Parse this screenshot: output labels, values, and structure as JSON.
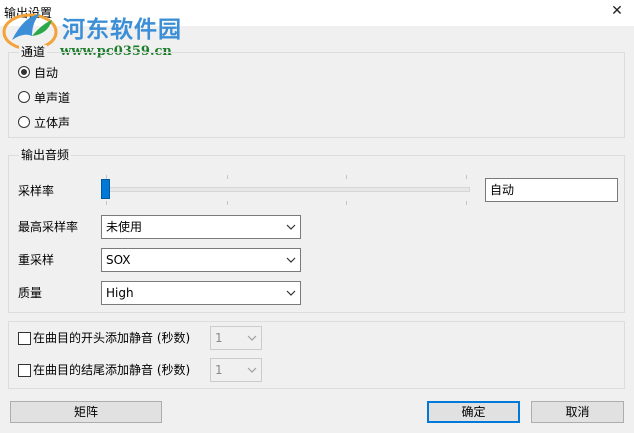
{
  "window": {
    "title": "输出设置",
    "close_glyph": "✕"
  },
  "watermark": {
    "title": "河东软件园",
    "url": "www.pc0359.cn"
  },
  "channel_group": {
    "legend": "通道",
    "options": [
      {
        "label": "自动",
        "checked": true
      },
      {
        "label": "单声道",
        "checked": false
      },
      {
        "label": "立体声",
        "checked": false
      }
    ]
  },
  "audio_group": {
    "legend": "输出音频",
    "sample_rate_label": "采样率",
    "sample_rate_value": "自动",
    "sample_rate_slider_level": 0,
    "max_rate_label": "最高采样率",
    "max_rate_value": "未使用",
    "resample_label": "重采样",
    "resample_value": "SOX",
    "quality_label": "质量",
    "quality_value": "High"
  },
  "silence_group": {
    "start_label": "在曲目的开头添加静音 (秒数)",
    "start_value": "1",
    "start_checked": false,
    "end_label": "在曲目的结尾添加静音 (秒数)",
    "end_value": "1",
    "end_checked": false
  },
  "buttons": {
    "matrix": "矩阵",
    "ok": "确定",
    "cancel": "取消"
  },
  "icons": {
    "close": "close-icon",
    "radio": "radio-button",
    "dropdown": "chevron-down-icon",
    "logo": "watermark-logo"
  }
}
